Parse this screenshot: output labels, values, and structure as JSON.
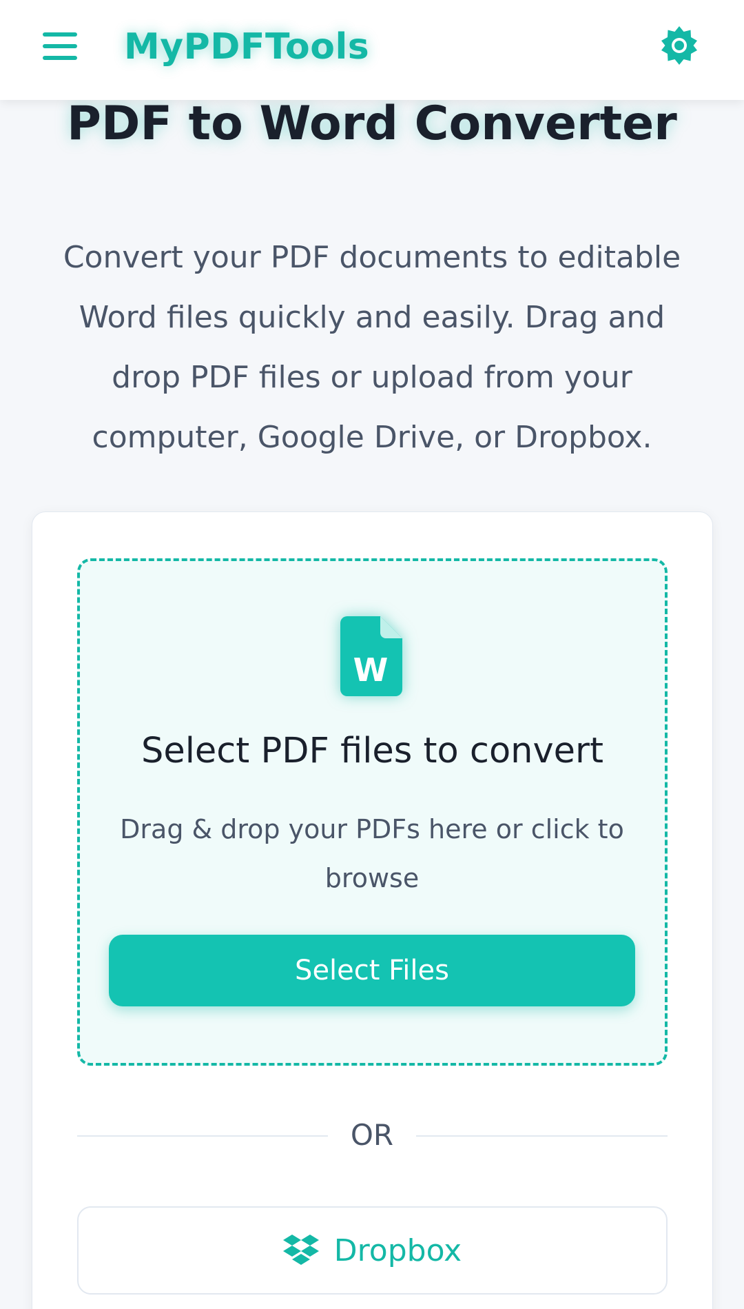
{
  "header": {
    "brand": "MyPDFTools",
    "menu_icon": "hamburger-menu-icon",
    "theme_icon": "sun-icon"
  },
  "hero": {
    "title": "PDF to Word Converter",
    "description": "Convert your PDF documents to editable Word files quickly and easily. Drag and drop PDF files or upload from your computer, Google Drive, or Dropbox."
  },
  "dropzone": {
    "icon": "word-file-icon",
    "title": "Select PDF files to convert",
    "subtitle": "Drag & drop your PDFs here or click to browse",
    "button_label": "Select Files"
  },
  "divider": {
    "label": "OR"
  },
  "cloud": {
    "dropbox_icon": "dropbox-icon",
    "dropbox_label": "Dropbox"
  },
  "colors": {
    "accent": "#14b8a6",
    "button": "#14c3b2",
    "text_dark": "#1a202c",
    "text_muted": "#4a5568",
    "background": "#f5f7fa"
  }
}
